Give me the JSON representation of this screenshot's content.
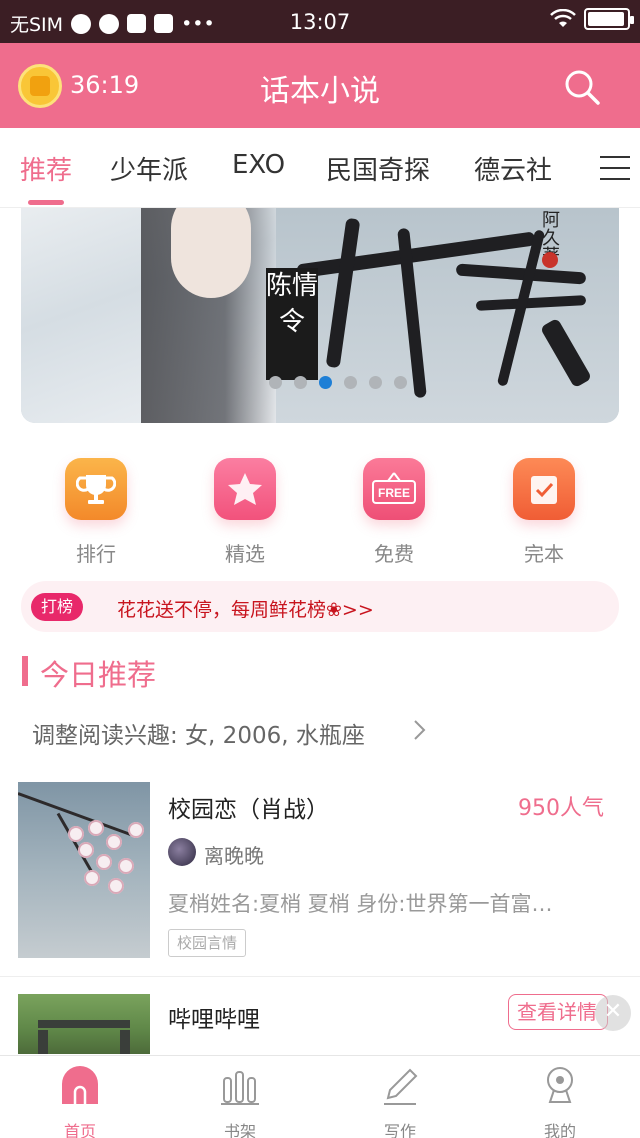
{
  "status_bar": {
    "carrier": "无SIM",
    "time": "13:07"
  },
  "header": {
    "timer": "36:19",
    "title": "话本小说"
  },
  "tabs": [
    {
      "label": "推荐"
    },
    {
      "label": "少年派"
    },
    {
      "label": "EXO"
    },
    {
      "label": "民国奇探"
    },
    {
      "label": "德云社"
    }
  ],
  "banner": {
    "series": "陈情令",
    "author_mark": "阿久著"
  },
  "categories": [
    {
      "label": "排行",
      "icon": "trophy-icon",
      "color": "#f7a23a"
    },
    {
      "label": "精选",
      "icon": "star-icon",
      "color": "#f6628a"
    },
    {
      "label": "免费",
      "icon": "free-icon",
      "color": "#f05a7f"
    },
    {
      "label": "完本",
      "icon": "check-note-icon",
      "color": "#f26a3f"
    }
  ],
  "promo": {
    "badge": "打榜",
    "text": "花花送不停，每周鲜花榜❀>>"
  },
  "section": {
    "title": "今日推荐",
    "interest": "调整阅读兴趣: 女, 2006, 水瓶座"
  },
  "books": [
    {
      "title": "校园恋（肖战）",
      "popularity": "950人气",
      "author": "离晚晚",
      "desc": "夏梢姓名:夏梢 夏梢 身份:世界第一首富…",
      "tag": "校园言情"
    },
    {
      "title": "哔哩哔哩",
      "detail": "查看详情"
    }
  ],
  "bottom_nav": [
    {
      "label": "首页",
      "icon": "home-icon"
    },
    {
      "label": "书架",
      "icon": "bookshelf-icon"
    },
    {
      "label": "写作",
      "icon": "pen-icon"
    },
    {
      "label": "我的",
      "icon": "profile-icon"
    }
  ],
  "colors": {
    "accent": "#ef6d8d",
    "status_bar": "#3b1e24",
    "promo_red": "#c8141e"
  }
}
